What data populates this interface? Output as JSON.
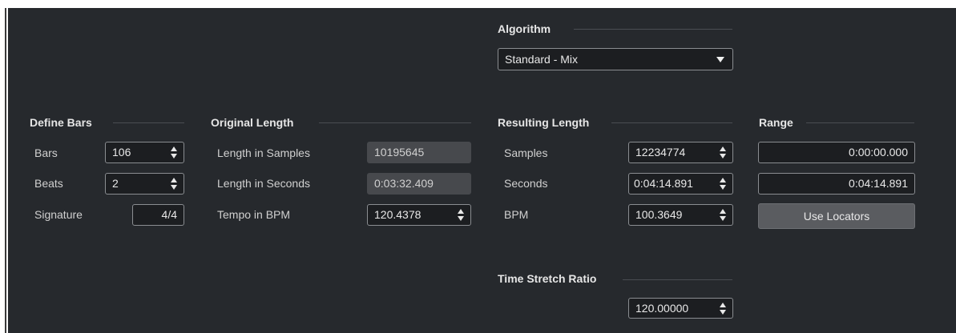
{
  "algorithm": {
    "heading": "Algorithm",
    "value": "Standard - Mix"
  },
  "define_bars": {
    "heading": "Define Bars",
    "bars_label": "Bars",
    "bars_value": "106",
    "beats_label": "Beats",
    "beats_value": "2",
    "signature_label": "Signature",
    "signature_value": "4/4"
  },
  "original_length": {
    "heading": "Original Length",
    "samples_label": "Length in Samples",
    "samples_value": "10195645",
    "seconds_label": "Length in Seconds",
    "seconds_value": "0:03:32.409",
    "tempo_label": "Tempo in BPM",
    "tempo_value": "120.4378"
  },
  "resulting_length": {
    "heading": "Resulting Length",
    "samples_label": "Samples",
    "samples_value": "12234774",
    "seconds_label": "Seconds",
    "seconds_value": "0:04:14.891",
    "bpm_label": "BPM",
    "bpm_value": "100.3649"
  },
  "range": {
    "heading": "Range",
    "start_value": "0:00:00.000",
    "end_value": "0:04:14.891",
    "use_locators_label": "Use Locators"
  },
  "time_stretch": {
    "heading": "Time Stretch Ratio",
    "value": "120.00000"
  }
}
